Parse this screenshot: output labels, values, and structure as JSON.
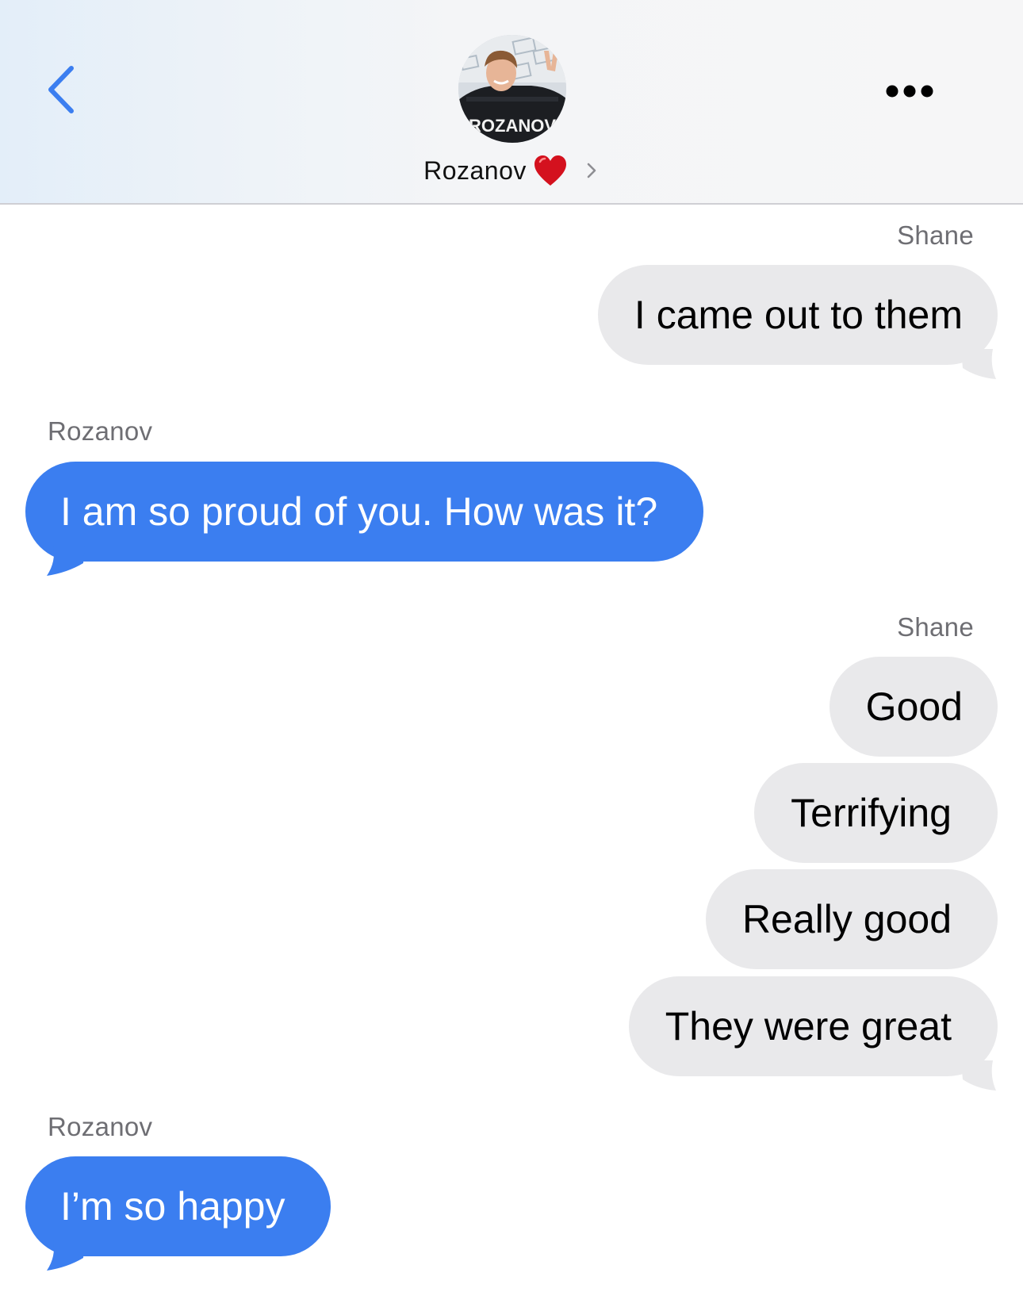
{
  "header": {
    "contact_name": "Rozanov",
    "avatar_jersey_text": "ROZANOV",
    "back_icon": "chevron-left-icon",
    "more_icon": "ellipsis-icon",
    "heart_icon": "red-heart-emoji",
    "accent_color": "#3b7ef0"
  },
  "messages": [
    {
      "sender": "Shane",
      "text": "I came out to them",
      "direction": "outgoing"
    },
    {
      "sender": "Rozanov",
      "text": "I am so proud of you. How was it?",
      "direction": "incoming"
    },
    {
      "sender": "Shane",
      "text": "Good",
      "direction": "outgoing"
    },
    {
      "sender": "",
      "text": "Terrifying",
      "direction": "outgoing"
    },
    {
      "sender": "",
      "text": "Really good",
      "direction": "outgoing"
    },
    {
      "sender": "",
      "text": "They were great",
      "direction": "outgoing"
    },
    {
      "sender": "Rozanov",
      "text": "I’m so happy",
      "direction": "incoming"
    }
  ],
  "colors": {
    "incoming_bubble": "#3b7ef0",
    "outgoing_bubble": "#e9e9eb",
    "sender_label": "#6e6e73"
  }
}
